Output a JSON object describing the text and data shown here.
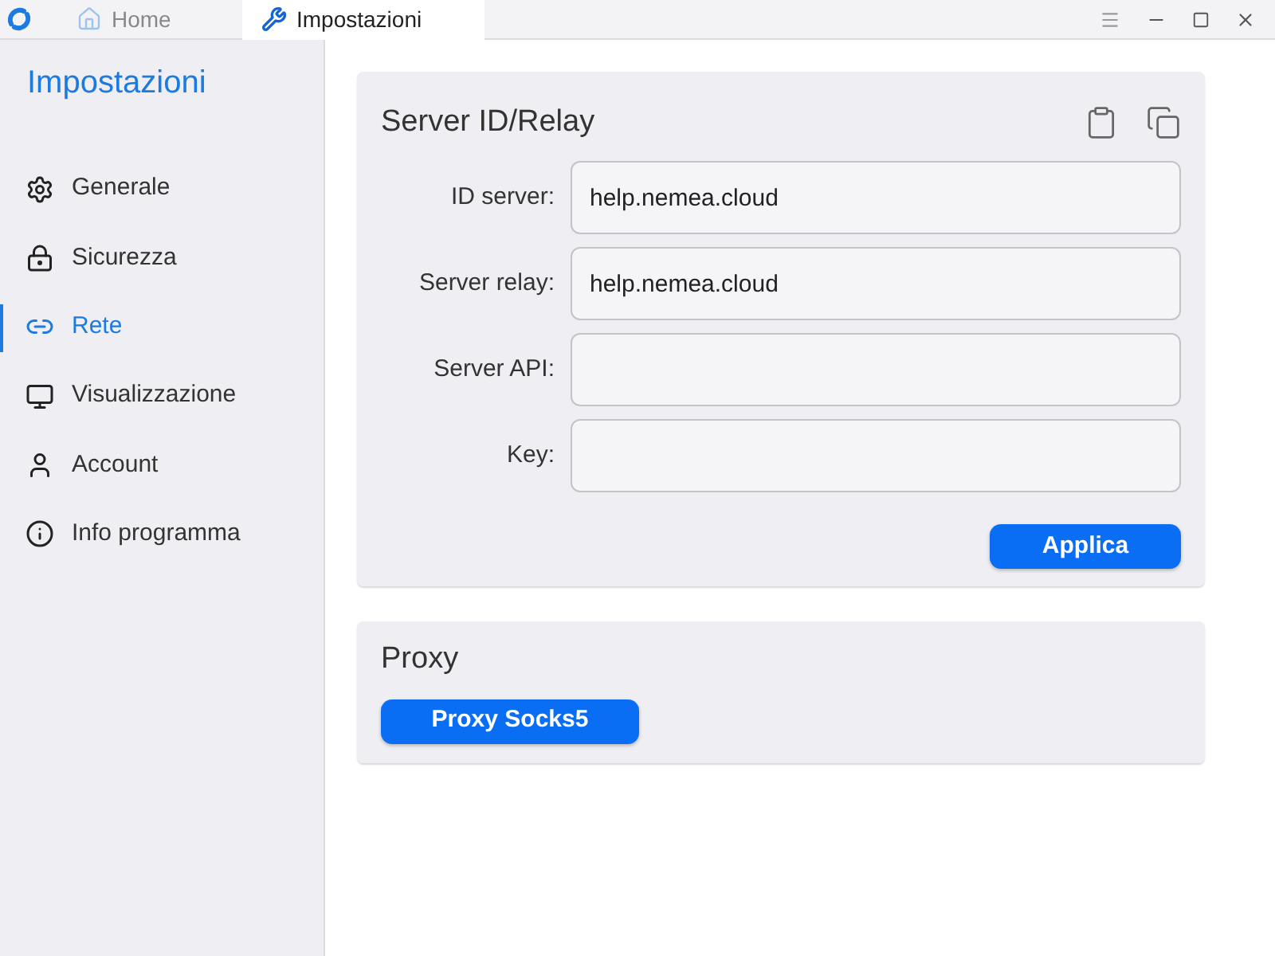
{
  "tabs": [
    {
      "label": "Home",
      "selected": false
    },
    {
      "label": "Impostazioni",
      "selected": true
    }
  ],
  "sidebar": {
    "title": "Impostazioni",
    "items": [
      {
        "label": "Generale",
        "selected": false
      },
      {
        "label": "Sicurezza",
        "selected": false
      },
      {
        "label": "Rete",
        "selected": true
      },
      {
        "label": "Visualizzazione",
        "selected": false
      },
      {
        "label": "Account",
        "selected": false
      },
      {
        "label": "Info programma",
        "selected": false
      }
    ]
  },
  "server_card": {
    "title": "Server ID/Relay",
    "fields": [
      {
        "label": "ID server:",
        "value": "help.nemea.cloud"
      },
      {
        "label": "Server relay:",
        "value": "help.nemea.cloud"
      },
      {
        "label": "Server API:"
      },
      {
        "label": "Key:"
      }
    ],
    "button": "Applica"
  },
  "proxy_card": {
    "title": "Proxy",
    "button": "Proxy Socks5"
  }
}
